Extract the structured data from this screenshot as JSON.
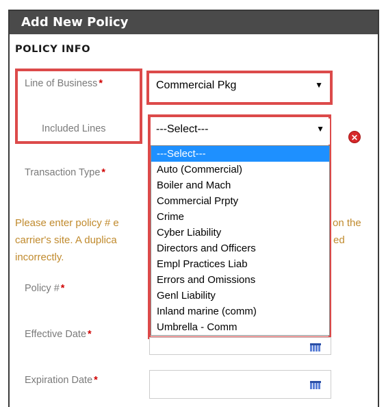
{
  "dialog": {
    "title": "Add New Policy"
  },
  "section": {
    "title": "POLICY INFO"
  },
  "fields": {
    "line_of_business": {
      "label": "Line of Business",
      "value": "Commercial Pkg"
    },
    "included_lines": {
      "label": "Included Lines",
      "value": "---Select---"
    },
    "transaction_type": {
      "label": "Transaction Type"
    },
    "policy_number": {
      "label": "Policy #"
    },
    "effective_date": {
      "label": "Effective Date"
    },
    "expiration_date": {
      "label": "Expiration Date"
    }
  },
  "required_marker": "*",
  "warning": {
    "line1_a": "Please enter policy # e",
    "line1_b": "on the",
    "line2_a": "carrier's site. A duplica",
    "line2_b": "ed",
    "line3": "incorrectly."
  },
  "dropdown": {
    "options": [
      "---Select---",
      "Auto (Commercial)",
      "Boiler and Mach",
      "Commercial Prpty",
      "Crime",
      "Cyber Liability",
      "Directors and Officers",
      "Empl Practices Liab",
      "Errors and Omissions",
      "Genl Liability",
      "Inland marine (comm)",
      "Umbrella - Comm"
    ],
    "selected_index": 0
  },
  "icons": {
    "remove": "remove-icon",
    "calendar": "calendar-icon",
    "arrow": "▼"
  },
  "colors": {
    "highlight": "#dc4a4a",
    "title_bg": "#4a4a4a",
    "warning": "#c08a2d",
    "selected": "#1e90ff"
  }
}
